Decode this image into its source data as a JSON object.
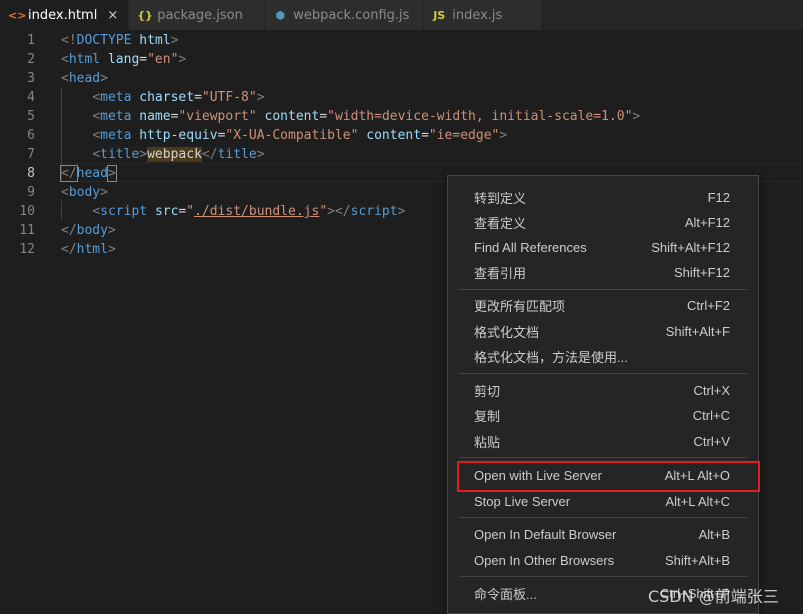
{
  "tabs": [
    {
      "icon": "<>",
      "label": "index.html",
      "close": "×",
      "icon_color": "#e37933"
    },
    {
      "icon": "{}",
      "label": "package.json",
      "icon_color": "#cbcb41"
    },
    {
      "icon": "⬢",
      "label": "webpack.config.js",
      "icon_color": "#519aba"
    },
    {
      "icon": "JS",
      "label": "index.js",
      "icon_color": "#cbcb41"
    }
  ],
  "editor": {
    "line_numbers": [
      "1",
      "2",
      "3",
      "4",
      "5",
      "6",
      "7",
      "8",
      "9",
      "10",
      "11",
      "12"
    ],
    "current_line": 8,
    "lines": {
      "l1": {
        "open": "<!",
        "doctype": "DOCTYPE",
        "sp": " ",
        "html": "html",
        "close": ">"
      },
      "l2": {
        "open": "<",
        "tag": "html",
        "sp": " ",
        "attr": "lang",
        "eq": "=",
        "val": "\"en\"",
        "close": ">"
      },
      "l3": {
        "open": "<",
        "tag": "head",
        "close": ">"
      },
      "l4": {
        "indent": "    ",
        "open": "<",
        "tag": "meta",
        "sp": " ",
        "attr": "charset",
        "eq": "=",
        "val": "\"UTF-8\"",
        "close": ">"
      },
      "l5": {
        "indent": "    ",
        "open": "<",
        "tag": "meta",
        "sp": " ",
        "attr1": "name",
        "eq1": "=",
        "val1": "\"viewport\"",
        "sp2": " ",
        "attr2": "content",
        "eq2": "=",
        "val2": "\"width=device-width, initial-scale=1.0\"",
        "close": ">"
      },
      "l6": {
        "indent": "    ",
        "open": "<",
        "tag": "meta",
        "sp": " ",
        "attr1": "http-equiv",
        "eq1": "=",
        "val1": "\"X-UA-Compatible\"",
        "sp2": " ",
        "attr2": "content",
        "eq2": "=",
        "val2": "\"ie=edge\"",
        "close": ">"
      },
      "l7": {
        "indent": "    ",
        "open": "<",
        "tag": "title",
        "close": ">",
        "text": "webpack",
        "open2": "</",
        "tag2": "title",
        "close2": ">"
      },
      "l8": {
        "open": "</",
        "tag": "head",
        "close": ">"
      },
      "l9": {
        "open": "<",
        "tag": "body",
        "close": ">"
      },
      "l10": {
        "indent": "    ",
        "open": "<",
        "tag": "script",
        "sp": " ",
        "attr": "src",
        "eq": "=",
        "val_q1": "\"",
        "val": "./dist/bundle.js",
        "val_q2": "\"",
        "close": ">",
        "open2": "</",
        "tag2": "script",
        "close2": ">"
      },
      "l11": {
        "open": "</",
        "tag": "body",
        "close": ">"
      },
      "l12": {
        "open": "</",
        "tag": "html",
        "close": ">"
      }
    }
  },
  "context_menu": {
    "items": [
      {
        "label": "转到定义",
        "key": "F12"
      },
      {
        "label": "查看定义",
        "key": "Alt+F12"
      },
      {
        "label": "Find All References",
        "key": "Shift+Alt+F12"
      },
      {
        "label": "查看引用",
        "key": "Shift+F12"
      },
      {
        "label": "更改所有匹配项",
        "key": "Ctrl+F2"
      },
      {
        "label": "格式化文档",
        "key": "Shift+Alt+F"
      },
      {
        "label": "格式化文档，方法是使用...",
        "key": ""
      },
      {
        "label": "剪切",
        "key": "Ctrl+X"
      },
      {
        "label": "复制",
        "key": "Ctrl+C"
      },
      {
        "label": "粘贴",
        "key": "Ctrl+V"
      },
      {
        "label": "Open with Live Server",
        "key": "Alt+L Alt+O"
      },
      {
        "label": "Stop Live Server",
        "key": "Alt+L Alt+C"
      },
      {
        "label": "Open In Default Browser",
        "key": "Alt+B"
      },
      {
        "label": "Open In Other Browsers",
        "key": "Shift+Alt+B"
      },
      {
        "label": "命令面板...",
        "key": "Ctrl+Shift+P"
      }
    ],
    "highlight_color": "#e02020"
  },
  "watermark": "CSDN @前端张三"
}
